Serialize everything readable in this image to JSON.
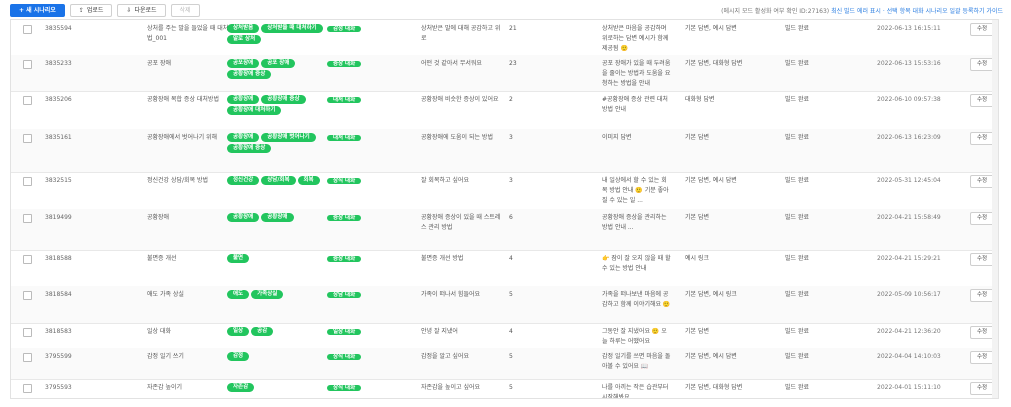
{
  "toolbar": {
    "new_label": "+ 새 시나리오",
    "upload_label": "업로드",
    "download_label": "다운로드",
    "delete_label": "삭제",
    "notice_prefix": "(메시지 모드 활성화 여부 확인 ID:27163)",
    "notice_link": "최신 빌드 에러 표시 · 선택 항목 대화 시나리오 일괄 등록하기 가이드"
  },
  "rows": [
    {
      "id": "3835594",
      "title": "상처를 주는 말을 들었을 때 대처법_001",
      "tags": [
        "상처받음",
        "상처받을 때 대처하기",
        "말로 상처"
      ],
      "category": "감정 대화",
      "message": "상처받은 말에 대해 공감하고 위로",
      "count": "21",
      "reply": "상처받은 마음을 공감하며 위로하는 답변 예시가 함께 제공됨 🙂",
      "atype": "기본 답변, 예시 답변",
      "status": "빌드 완료",
      "date": "2022-06-13 16:15:11",
      "edit": "수정"
    },
    {
      "id": "3835233",
      "title": "공포 장애",
      "tags": [
        "공포장애",
        "공포 장애",
        "공황장애 증상"
      ],
      "category": "증상 대화",
      "message": "어떤 것 같아서 무서워요",
      "count": "23",
      "reply": "공포 장애가 있을 때 두려움을 줄이는 방법과 도움을 요청하는 방법을 안내",
      "atype": "기본 답변, 대화형 답변",
      "status": "빌드 완료",
      "date": "2022-06-13 15:53:16",
      "edit": "수정"
    },
    {
      "id": "3835206",
      "title": "공황장애 복합 증상 대처방법",
      "tags": [
        "공황장애",
        "공황장애 증상",
        "공황장애 대처하기"
      ],
      "category": "대처 대화",
      "message": "공황장애 비슷한 증상이 있어요",
      "count": "2",
      "reply": "#공황장애 증상 관련 대처 방법 안내",
      "atype": "대화형 답변",
      "status": "빌드 완료",
      "date": "2022-06-10 09:57:38",
      "edit": "수정"
    },
    {
      "id": "3835161",
      "title": "공황장애에서 벗어나기 위해",
      "tags": [
        "공황장애",
        "공황장애 벗어나기",
        "공황장애 증상"
      ],
      "category": "대처 대화",
      "message": "공황장애에 도움이 되는 방법",
      "count": "3",
      "reply": "이미지 답변",
      "atype": "기본 답변",
      "status": "빌드 완료",
      "date": "2022-06-13 16:23:09",
      "edit": "수정"
    },
    {
      "id": "3832515",
      "title": "정신건강 상담/회복 방법",
      "tags": [
        "정신건강",
        "상담/회복",
        "회복"
      ],
      "category": "상식 대화",
      "message": "잘 회복하고 싶어요",
      "count": "3",
      "reply": "내 일상에서 할 수 있는 회복 방법 안내 🙂 기분 좋아질 수 있는 일 ...",
      "atype": "기본 답변, 예시 답변",
      "status": "빌드 완료",
      "date": "2022-05-31 12:45:04",
      "edit": "수정"
    },
    {
      "id": "3819499",
      "title": "공황장애",
      "tags": [
        "공황장애",
        "공황장애"
      ],
      "category": "증상 대화",
      "message": "공황장애 증상이 있을 때 스트레스 관리 방법",
      "count": "6",
      "reply": "공황장애 증상을 관리하는 방법 안내 ...",
      "atype": "기본 답변",
      "status": "빌드 완료",
      "date": "2022-04-21 15:58:49",
      "edit": "수정"
    },
    {
      "id": "3818588",
      "title": "불면증 개선",
      "tags": [
        "불면"
      ],
      "category": "증상 대화",
      "message": "불면증 개선 방법",
      "count": "4",
      "reply": "👉 잠이 잘 오지 않을 때 할 수 있는 방법 안내",
      "atype": "예시 링크",
      "status": "빌드 완료",
      "date": "2022-04-21 15:29:21",
      "edit": "수정"
    },
    {
      "id": "3818584",
      "title": "애도 가족 상실",
      "tags": [
        "애도",
        "가족상실"
      ],
      "category": "상담 대화",
      "message": "가족이 떠나서 힘들어요",
      "count": "5",
      "reply": "가족을 떠나보낸 마음에 공감하고 함께 이야기해요 🙂",
      "atype": "기본 답변, 예시 링크",
      "status": "빌드 완료",
      "date": "2022-05-09 10:56:17",
      "edit": "수정"
    },
    {
      "id": "3818583",
      "title": "일상 대화",
      "tags": [
        "일상",
        "공감"
      ],
      "category": "일상 대화",
      "message": "안녕 잘 지냈어",
      "count": "4",
      "reply": "그동안 잘 지냈어요 🙂 오늘 하루는 어땠어요",
      "atype": "기본 답변",
      "status": "빌드 완료",
      "date": "2022-04-21 12:36:20",
      "edit": "수정"
    },
    {
      "id": "3795599",
      "title": "감정 일기 쓰기",
      "tags": [
        "감정"
      ],
      "category": "상식 대화",
      "message": "감정을 알고 싶어요",
      "count": "5",
      "reply": "감정 일기를 쓰면 마음을 돌아볼 수 있어요 📖",
      "atype": "기본 답변, 예시 답변",
      "status": "빌드 완료",
      "date": "2022-04-04 14:10:03",
      "edit": "수정"
    },
    {
      "id": "3795593",
      "title": "자존감 높이기",
      "tags": [
        "자존감"
      ],
      "category": "상식 대화",
      "message": "자존감을 높이고 싶어요",
      "count": "5",
      "reply": "나를 아끼는 작은 습관부터 시작해봐요",
      "atype": "기본 답변, 대화형 답변",
      "status": "빌드 완료",
      "date": "2022-04-01 15:11:10",
      "edit": "수정"
    }
  ]
}
